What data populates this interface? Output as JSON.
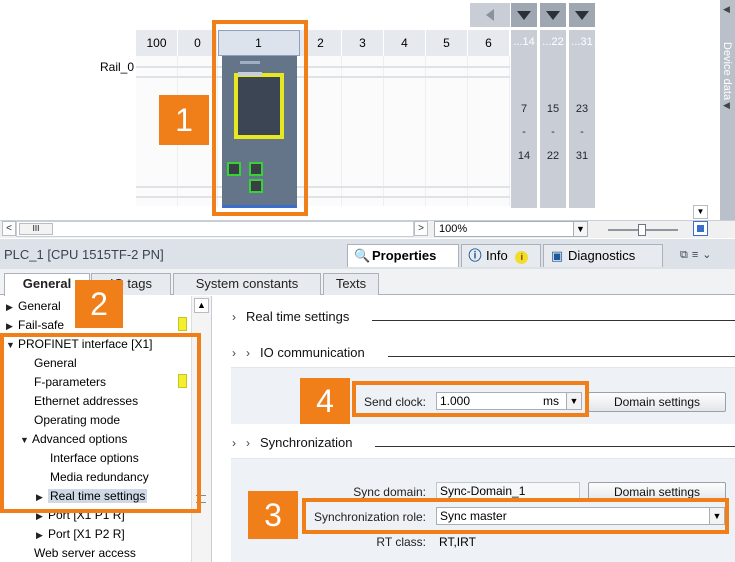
{
  "device_view": {
    "rail_label": "Rail_0",
    "slots": [
      "100",
      "0",
      "1",
      "2",
      "3",
      "4",
      "5",
      "6"
    ],
    "expansion": [
      {
        "header": "...14",
        "top": "7",
        "mid": "-",
        "bottom": "14"
      },
      {
        "header": "...22",
        "top": "15",
        "mid": "-",
        "bottom": "22"
      },
      {
        "header": "...31",
        "top": "23",
        "mid": "-",
        "bottom": "31"
      }
    ],
    "device_data_tab": "Device data"
  },
  "callouts": [
    "1",
    "2",
    "3",
    "4"
  ],
  "toolbar": {
    "scroll_left": "<",
    "scroll_grip": "III",
    "scroll_right": ">",
    "zoom": "100%"
  },
  "inspector": {
    "title": "PLC_1 [CPU 1515TF-2 PN]",
    "tabs": [
      "Properties",
      "Info",
      "Diagnostics"
    ],
    "subtabs": [
      "General",
      "IO tags",
      "System constants",
      "Texts"
    ]
  },
  "tree": {
    "items": [
      {
        "label": "General",
        "arrow": "▶"
      },
      {
        "label": "Fail-safe",
        "arrow": "▶"
      },
      {
        "label": "PROFINET interface [X1]",
        "arrow": "▼"
      },
      {
        "label": "General",
        "arrow": ""
      },
      {
        "label": "F-parameters",
        "arrow": ""
      },
      {
        "label": "Ethernet addresses",
        "arrow": ""
      },
      {
        "label": "Operating mode",
        "arrow": ""
      },
      {
        "label": "Advanced options",
        "arrow": "▼"
      },
      {
        "label": "Interface options",
        "arrow": ""
      },
      {
        "label": "Media redundancy",
        "arrow": ""
      },
      {
        "label": "Real time settings",
        "arrow": "▶"
      },
      {
        "label": "Port [X1 P1 R]",
        "arrow": "▶"
      },
      {
        "label": "Port [X1 P2 R]",
        "arrow": "▶"
      },
      {
        "label": "Web server access",
        "arrow": ""
      }
    ]
  },
  "panel": {
    "real_time_settings": "Real time settings",
    "io_communication": "IO communication",
    "send_clock_label": "Send clock:",
    "send_clock_value": "1.000",
    "send_clock_unit": "ms",
    "domain_settings": "Domain settings",
    "synchronization": "Synchronization",
    "sync_domain_label": "Sync domain:",
    "sync_domain_value": "Sync-Domain_1",
    "sync_role_label": "Synchronization role:",
    "sync_role_value": "Sync master",
    "rt_class_label": "RT class:",
    "rt_class_value": "RT,IRT"
  },
  "colors": {
    "accent": "#f07e19",
    "highlight": "#e8e820",
    "port": "#36d236"
  }
}
